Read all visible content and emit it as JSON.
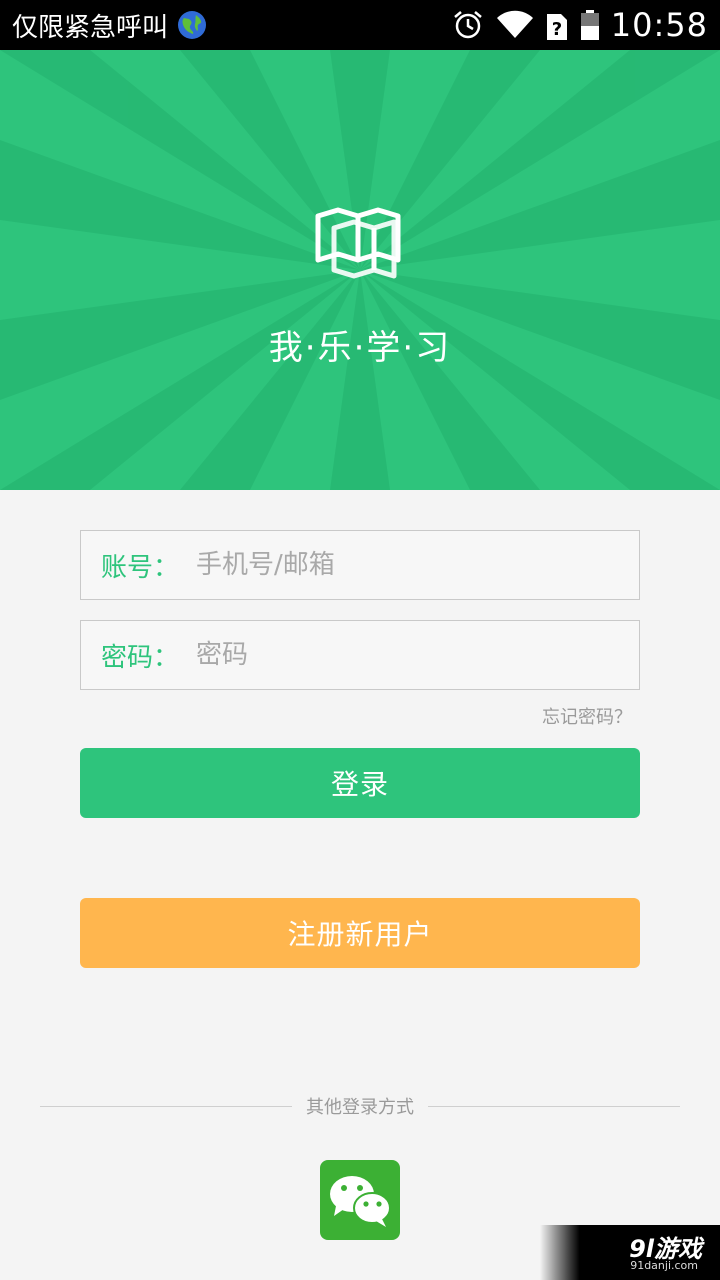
{
  "status_bar": {
    "carrier_text": "仅限紧急呼叫",
    "time": "10:58",
    "icons": [
      "globe-icon",
      "alarm-icon",
      "wifi-icon",
      "no-sim-icon",
      "battery-icon"
    ]
  },
  "header": {
    "title": "我·乐·学·习",
    "background_color": "#2ec47c"
  },
  "form": {
    "account_label": "账号：",
    "account_placeholder": "手机号/邮箱",
    "password_label": "密码：",
    "password_placeholder": "密码",
    "forgot_password": "忘记密码？"
  },
  "buttons": {
    "login": "登录",
    "register": "注册新用户",
    "login_color": "#2ec47c",
    "register_color": "#ffb64e"
  },
  "other_login": {
    "label": "其他登录方式",
    "providers": [
      "wechat-icon"
    ]
  },
  "watermark": {
    "text": "9l游戏",
    "sub": "91danji.com"
  }
}
